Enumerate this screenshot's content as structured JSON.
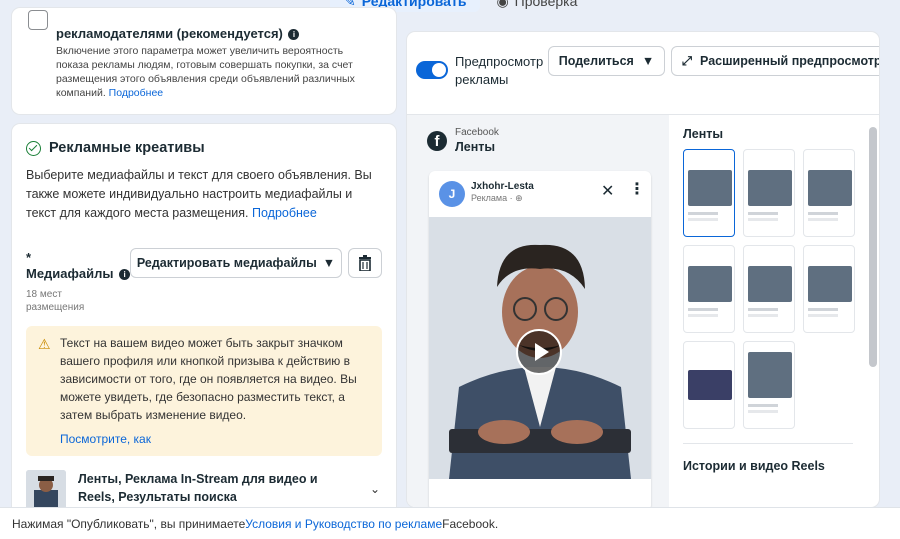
{
  "top_tabs": {
    "edit_label": "Редактировать",
    "review_label": "Проверка"
  },
  "option": {
    "title": "рекламодателями (рекомендуется)",
    "description": "Включение этого параметра может увеличить вероятность показа рекламы людям, готовым совершать покупки, за счет размещения этого объявления среди объявлений различных компаний.",
    "more_link": "Подробнее"
  },
  "creatives": {
    "title": "Рекламные креативы",
    "description": "Выберите медиафайлы и текст для своего объявления. Вы также можете индивидуально настроить медиафайлы и текст для каждого места размещения.",
    "more_link": "Подробнее",
    "required_mark": "*",
    "media_label": "Медиафайлы",
    "media_sub": "18 мест размещения",
    "edit_media_button": "Редактировать медиафайлы",
    "warning_text": "Текст на вашем видео может быть закрыт значком вашего профиля или кнопкой призыва к действию в зависимости от того, где он появляется на видео. Вы можете увидеть, где безопасно разместить текст, а затем выбрать изменение видео.",
    "warning_link": "Посмотрите, как",
    "placement_text": "Ленты, Реклама In-Stream для видео и Reels, Результаты поиска"
  },
  "preview": {
    "toggle_label": "Предпросмотр рекламы",
    "share_button": "Поделиться",
    "advanced_button": "Расширенный предпросмотр",
    "platform": "Facebook",
    "placement": "Ленты",
    "post_avatar_letter": "J",
    "post_name": "Jxhohr-Lesta",
    "post_sub": "Реклама · ",
    "thumbs_title": "Ленты",
    "stories_title": "Истории и видео Reels"
  },
  "footer": {
    "prefix": "Нажимая \"Опубликовать\", вы принимаете ",
    "link": "Условия и Руководство по рекламе",
    "suffix": " Facebook."
  },
  "colors": {
    "accent": "#0a66d8",
    "success": "#1a7f37",
    "warning_bg": "#fdf3dc"
  }
}
